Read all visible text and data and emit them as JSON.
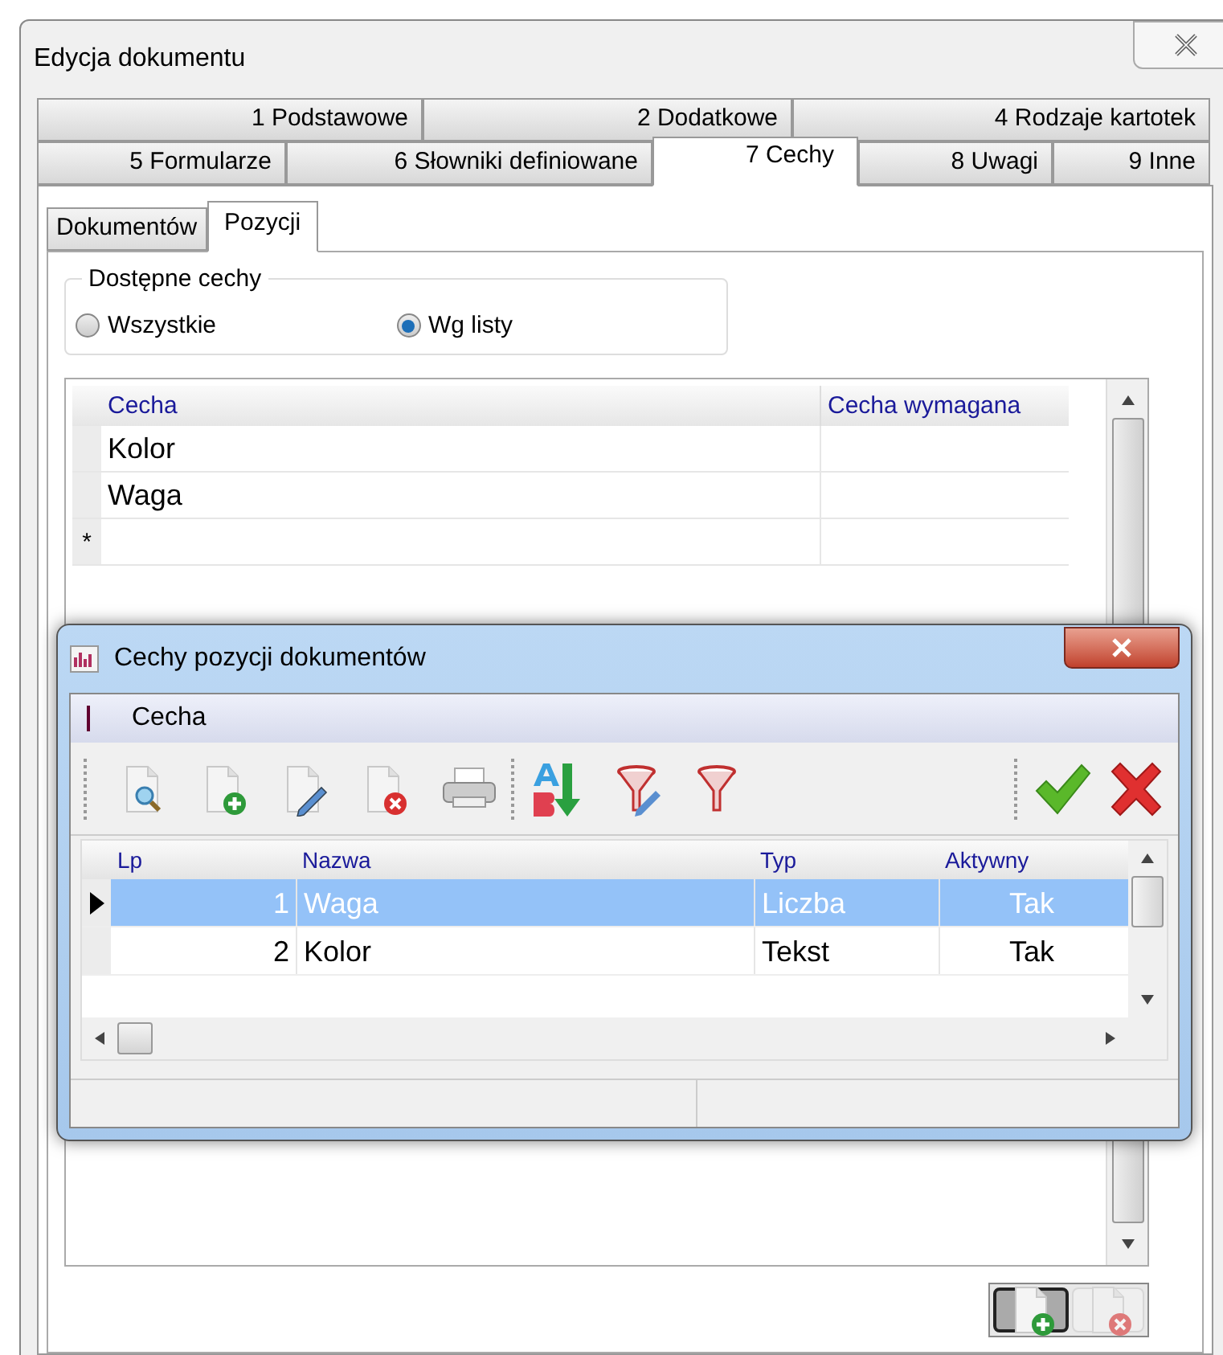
{
  "window": {
    "title": "Edycja dokumentu"
  },
  "tab_rows": [
    {
      "tabs": [
        {
          "label": "1 Podstawowe",
          "selected": false
        },
        {
          "label": "2 Dodatkowe",
          "selected": false
        },
        {
          "label": "4 Rodzaje kartotek",
          "selected": false
        }
      ]
    },
    {
      "tabs": [
        {
          "label": "5 Formularze",
          "selected": false
        },
        {
          "label": "6 Słowniki definiowane",
          "selected": false
        },
        {
          "label": "7 Cechy",
          "selected": true
        },
        {
          "label": "8 Uwagi",
          "selected": false
        },
        {
          "label": "9 Inne",
          "selected": false
        }
      ]
    }
  ],
  "subtabs": [
    {
      "label": "Dokumentów",
      "selected": false
    },
    {
      "label": "Pozycji",
      "selected": true
    }
  ],
  "group": {
    "title": "Dostępne cechy",
    "options": [
      {
        "label": "Wszystkie",
        "selected": false
      },
      {
        "label": "Wg listy",
        "selected": true
      }
    ]
  },
  "features_table": {
    "columns": [
      "Cecha",
      "Cecha wymagana"
    ],
    "rows": [
      {
        "cells": [
          "Kolor",
          ""
        ]
      },
      {
        "cells": [
          "Waga",
          ""
        ]
      }
    ],
    "new_row_marker": "*"
  },
  "dialog": {
    "title": "Cechy pozycji dokumentów",
    "menu": [
      "Cecha"
    ],
    "table": {
      "columns": [
        "Lp",
        "Nazwa",
        "Typ",
        "Aktywny"
      ],
      "rows": [
        {
          "cells": [
            "1",
            "Waga",
            "Liczba",
            "Tak"
          ],
          "selected": true
        },
        {
          "cells": [
            "2",
            "Kolor",
            "Tekst",
            "Tak"
          ],
          "selected": false
        }
      ]
    }
  }
}
